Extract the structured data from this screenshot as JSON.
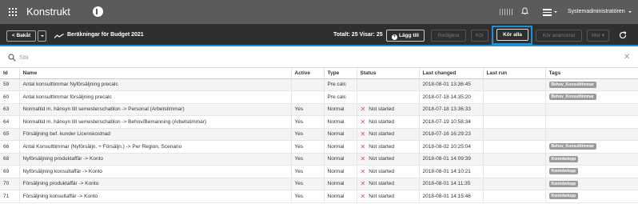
{
  "app": {
    "brand": "Konstrukt",
    "user": "Systemadministratören"
  },
  "toolbar": {
    "back_label": "< Bakåt",
    "title": "Beräkningar för Budget 2021",
    "totals": "Totalt: 25 Visar: 25",
    "add_label": "Lägg till",
    "edit_label": "Redigera",
    "run_label": "Kör",
    "run_all_label": "Kör alla",
    "run_advanced_label": "Kör avancerat",
    "more_label": "Mer"
  },
  "search": {
    "placeholder": "Sök",
    "value": ""
  },
  "table": {
    "columns": [
      "Id",
      "Name",
      "Active",
      "Type",
      "Status",
      "Last changed",
      "Last run",
      "Tags"
    ],
    "rows": [
      {
        "id": "59",
        "name": "Antal konsulttimmar Nyförsäljning precalc",
        "active": "",
        "type": "Pre calc",
        "status": "",
        "changed": "2018-08-01 13:36:45",
        "run": "",
        "tag": "Behov_Konsulttimmar"
      },
      {
        "id": "60",
        "name": "Antal konsulttimmar försäljning precalc",
        "active": "",
        "type": "Pre calc",
        "status": "",
        "changed": "2018-07-18 14:35:20",
        "run": "",
        "tag": "Behov_Konsulttimmar"
      },
      {
        "id": "63",
        "name": "Normaltid m. hänsyn till semesterschablon -> Personal (Arbetstimmar)",
        "active": "Yes",
        "type": "Normal",
        "status": "Not started",
        "changed": "2018-07-18 13:36:33",
        "run": "",
        "tag": ""
      },
      {
        "id": "64",
        "name": "Normaltid m. hänsyn till semesterschablon -> Behov/Bemanning (Arbetstimmar)",
        "active": "Yes",
        "type": "Normal",
        "status": "Not started",
        "changed": "2018-07-19 10:58:34",
        "run": "",
        "tag": ""
      },
      {
        "id": "65",
        "name": "Försäljning bef. kunder Licenskostnad",
        "active": "Yes",
        "type": "Normal",
        "status": "Not started",
        "changed": "2018-07-16 16:29:23",
        "run": "",
        "tag": ""
      },
      {
        "id": "66",
        "name": "Antal Konsulttimmar (Nyförsäljn. + Försäljn.) -> Per Region, Scenario",
        "active": "Yes",
        "type": "Normal",
        "status": "Not started",
        "changed": "2018-08-02 10:25:04",
        "run": "",
        "tag": "Behov_Konsulttimmar"
      },
      {
        "id": "68",
        "name": "Nyförsäljning produktaffär -> Konto",
        "active": "Yes",
        "type": "Normal",
        "status": "Not started",
        "changed": "2018-08-01 14:09:39",
        "run": "",
        "tag": "Kontobelopp"
      },
      {
        "id": "69",
        "name": "Nyförsäljning konsultaffär -> Konto",
        "active": "Yes",
        "type": "Normal",
        "status": "Not started",
        "changed": "2018-08-01 14:10:21",
        "run": "",
        "tag": "Kontobelopp"
      },
      {
        "id": "70",
        "name": "Försäljning produktaffär -> Konto",
        "active": "Yes",
        "type": "Normal",
        "status": "Not started",
        "changed": "2018-08-01 14:11:35",
        "run": "",
        "tag": "Kontobelopp"
      },
      {
        "id": "71",
        "name": "Försäljning konsultaffär -> Konto",
        "active": "Yes",
        "type": "Normal",
        "status": "Not started",
        "changed": "2018-08-01 14:15:46",
        "run": "",
        "tag": "Kontobelopp"
      }
    ]
  }
}
